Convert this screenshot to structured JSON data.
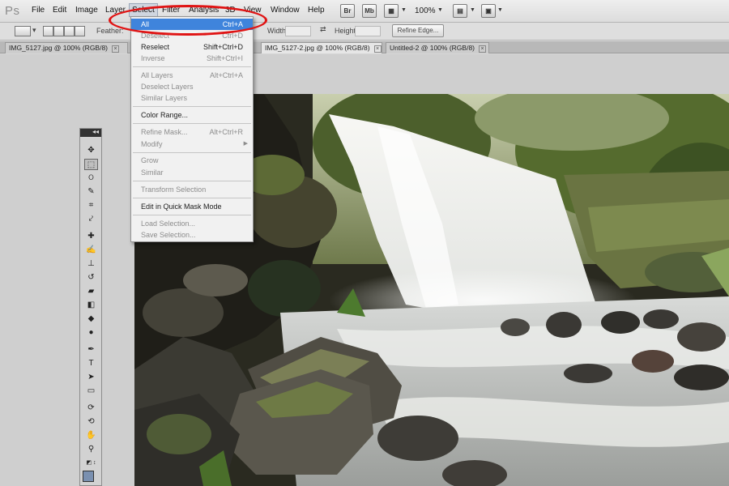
{
  "app": {
    "logo": "Ps"
  },
  "menubar": {
    "items": [
      "File",
      "Edit",
      "Image",
      "Layer",
      "Select",
      "Filter",
      "Analysis",
      "3D",
      "View",
      "Window",
      "Help"
    ],
    "bridge_label": "Br",
    "minibridge_label": "Mb",
    "zoom": "100%"
  },
  "options": {
    "feather_label": "Feather:",
    "width_label": "Width:",
    "height_label": "Height:",
    "refine_edge": "Refine Edge..."
  },
  "tabs": [
    {
      "label": "IMG_5127.jpg @ 100% (RGB/8)",
      "active": false
    },
    {
      "label": "IMG_5127-2.jpg @ 100% (RGB/8)",
      "active": true
    },
    {
      "label": "Untitled-2 @ 100% (RGB/8)",
      "active": false
    }
  ],
  "select_menu": {
    "items": [
      {
        "label": "All",
        "shortcut": "Ctrl+A",
        "enabled": true,
        "highlighted": true
      },
      {
        "label": "Deselect",
        "shortcut": "Ctrl+D",
        "enabled": false
      },
      {
        "label": "Reselect",
        "shortcut": "Shift+Ctrl+D",
        "enabled": true
      },
      {
        "label": "Inverse",
        "shortcut": "Shift+Ctrl+I",
        "enabled": false
      },
      {
        "label": "All Layers",
        "shortcut": "Alt+Ctrl+A",
        "enabled": false
      },
      {
        "label": "Deselect Layers",
        "shortcut": "",
        "enabled": false
      },
      {
        "label": "Similar Layers",
        "shortcut": "",
        "enabled": false
      },
      {
        "label": "Color Range...",
        "shortcut": "",
        "enabled": true
      },
      {
        "label": "Refine Mask...",
        "shortcut": "Alt+Ctrl+R",
        "enabled": false
      },
      {
        "label": "Modify",
        "shortcut": "",
        "enabled": false,
        "submenu": true
      },
      {
        "label": "Grow",
        "shortcut": "",
        "enabled": false
      },
      {
        "label": "Similar",
        "shortcut": "",
        "enabled": false
      },
      {
        "label": "Transform Selection",
        "shortcut": "",
        "enabled": false
      },
      {
        "label": "Edit in Quick Mask Mode",
        "shortcut": "",
        "enabled": true
      },
      {
        "label": "Load Selection...",
        "shortcut": "",
        "enabled": false
      },
      {
        "label": "Save Selection...",
        "shortcut": "",
        "enabled": false
      }
    ]
  },
  "tools": {
    "icons": [
      "move-tool",
      "rectangular-marquee-tool",
      "lasso-tool",
      "quick-selection-tool",
      "crop-tool",
      "eyedropper-tool",
      "spot-healing-brush-tool",
      "brush-tool",
      "clone-stamp-tool",
      "history-brush-tool",
      "eraser-tool",
      "gradient-tool",
      "blur-tool",
      "dodge-tool",
      "pen-tool",
      "type-tool",
      "path-selection-tool",
      "rectangle-tool",
      "3d-rotate-tool",
      "3d-orbit-tool",
      "hand-tool",
      "zoom-tool"
    ]
  },
  "colors": {
    "highlight": "#3f84dc",
    "annotation": "#e01414",
    "foreground_swatch": "#7a90b0"
  }
}
